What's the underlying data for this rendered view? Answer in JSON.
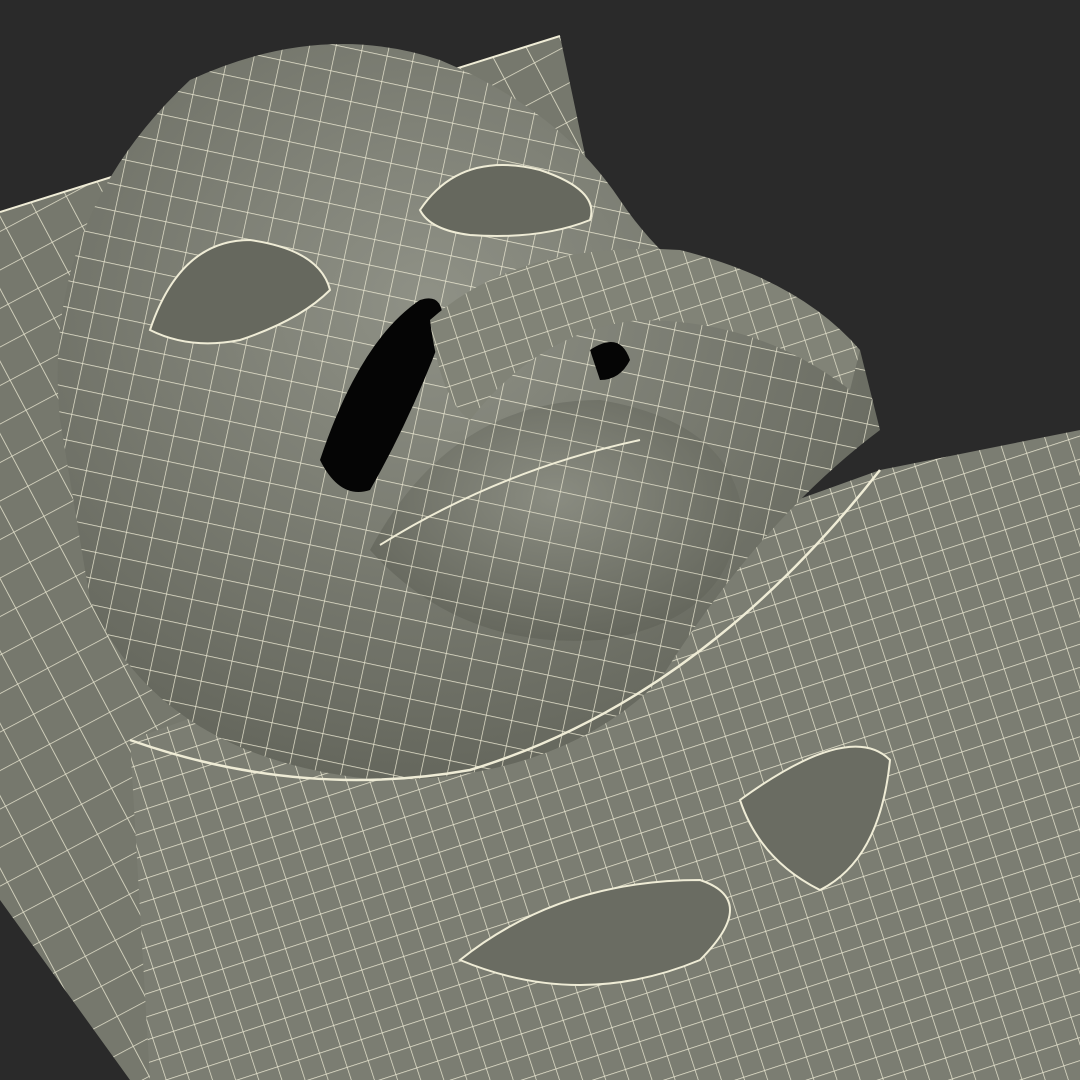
{
  "scene": {
    "subject": "wireframe-3d-model-render",
    "colors": {
      "background": "#2a2a2a",
      "surface": "#7d7f74",
      "surface_light": "#8f9186",
      "surface_dark": "#5f6157",
      "wire": "#efecd6",
      "cavity": "#050505"
    },
    "grid": true
  }
}
